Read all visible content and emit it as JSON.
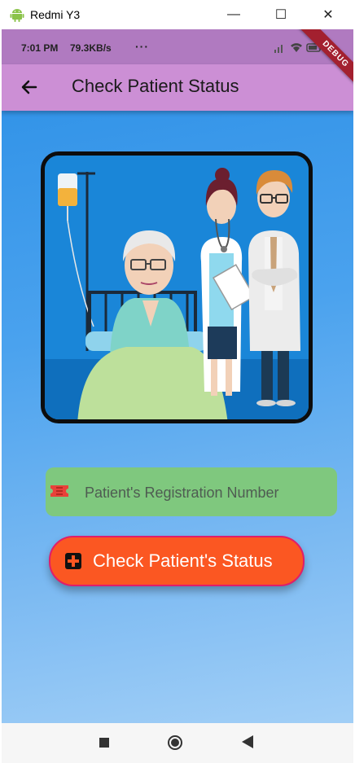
{
  "window": {
    "title": "Redmi Y3",
    "minimize_glyph": "—",
    "maximize_glyph": "☐",
    "close_glyph": "✕",
    "app_icon": "android-icon"
  },
  "status_bar": {
    "time": "7:01 PM",
    "speed": "79.3KB/s",
    "more": "···",
    "debug": "DEBUG"
  },
  "app_bar": {
    "title": "Check Patient Status",
    "back_icon": "arrow-left-icon"
  },
  "form": {
    "registration_placeholder": "Patient's Registration Number",
    "registration_value": "",
    "check_button_label": "Check Patient's Status",
    "field_icon": "ticket-icon",
    "button_icon": "medical-plus-icon"
  },
  "colors": {
    "app_bar": "#cc8fd5",
    "status_bar": "#b07ac0",
    "field": "#7fc87e",
    "button": "#fb5722",
    "button_border": "#e01e6a"
  },
  "nav": {
    "recents_icon": "square-icon",
    "home_icon": "circle-icon",
    "back_icon": "triangle-back-icon"
  }
}
